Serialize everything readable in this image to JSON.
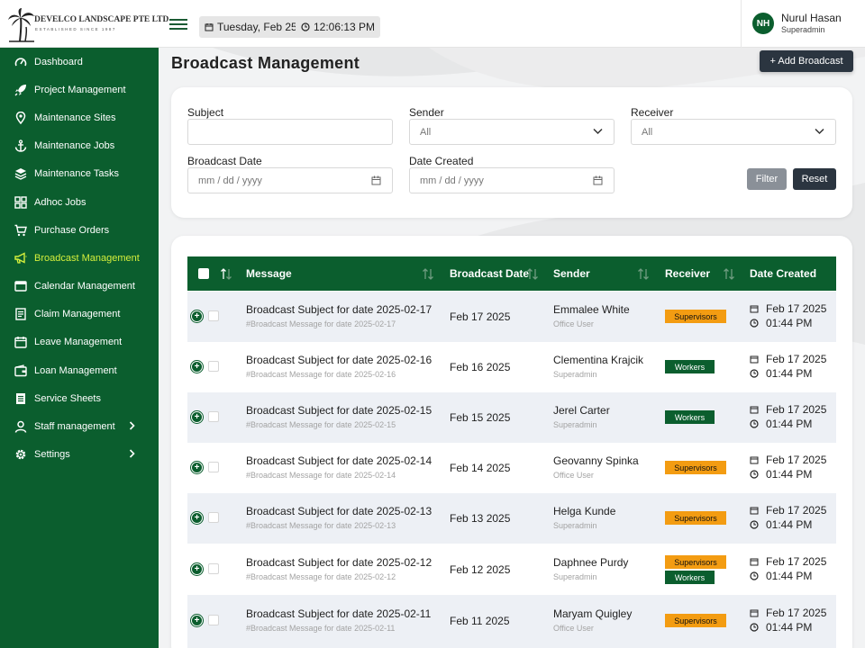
{
  "brand": {
    "name": "DEVELCO LANDSCAPE PTE LTD",
    "tagline": "ESTABLISHED SINCE 1987"
  },
  "header": {
    "date": "Tuesday, Feb 25",
    "time": "12:06:13 PM",
    "user": {
      "initials": "NH",
      "name": "Nurul Hasan",
      "role": "Superadmin"
    }
  },
  "sidebar": {
    "items": [
      {
        "label": "Dashboard",
        "icon": "gauge-icon"
      },
      {
        "label": "Project Management",
        "icon": "rocket-icon"
      },
      {
        "label": "Maintenance Sites",
        "icon": "map-pin-icon"
      },
      {
        "label": "Maintenance Jobs",
        "icon": "anchor-icon"
      },
      {
        "label": "Maintenance Tasks",
        "icon": "layers-icon"
      },
      {
        "label": "Adhoc Jobs",
        "icon": "grid-icon"
      },
      {
        "label": "Purchase Orders",
        "icon": "cart-icon"
      },
      {
        "label": "Broadcast Management",
        "icon": "megaphone-icon",
        "active": true
      },
      {
        "label": "Calendar Management",
        "icon": "calendar-window-icon"
      },
      {
        "label": "Claim Management",
        "icon": "document-icon"
      },
      {
        "label": "Leave Management",
        "icon": "calendar-icon"
      },
      {
        "label": "Loan Management",
        "icon": "wallet-icon"
      },
      {
        "label": "Service Sheets",
        "icon": "sheet-icon"
      },
      {
        "label": "Staff management",
        "icon": "user-icon",
        "has_submenu": true
      },
      {
        "label": "Settings",
        "icon": "gear-icon",
        "has_submenu": true
      }
    ]
  },
  "page": {
    "title": "Broadcast Management",
    "add_button": "+ Add Broadcast"
  },
  "filters": {
    "subject_label": "Subject",
    "subject_value": "",
    "sender_label": "Sender",
    "sender_value": "All",
    "receiver_label": "Receiver",
    "receiver_value": "All",
    "broadcast_date_label": "Broadcast Date",
    "broadcast_date_placeholder": "mm / dd / yyyy",
    "date_created_label": "Date Created",
    "date_created_placeholder": "mm / dd / yyyy",
    "filter_button": "Filter",
    "reset_button": "Reset"
  },
  "table": {
    "columns": [
      "Message",
      "Broadcast Date",
      "Sender",
      "Receiver",
      "Date Created"
    ],
    "rows": [
      {
        "subject": "Broadcast Subject for date 2025-02-17",
        "message": "#Broadcast Message for date 2025-02-17",
        "broadcast_date": "Feb 17 2025",
        "sender": "Emmalee White",
        "sender_role": "Office User",
        "receivers": [
          "Supervisors"
        ],
        "created_date": "Feb 17 2025",
        "created_time": "01:44 PM"
      },
      {
        "subject": "Broadcast Subject for date 2025-02-16",
        "message": "#Broadcast Message for date 2025-02-16",
        "broadcast_date": "Feb 16 2025",
        "sender": "Clementina Krajcik",
        "sender_role": "Superadmin",
        "receivers": [
          "Workers"
        ],
        "created_date": "Feb 17 2025",
        "created_time": "01:44 PM"
      },
      {
        "subject": "Broadcast Subject for date 2025-02-15",
        "message": "#Broadcast Message for date 2025-02-15",
        "broadcast_date": "Feb 15 2025",
        "sender": "Jerel Carter",
        "sender_role": "Superadmin",
        "receivers": [
          "Workers"
        ],
        "created_date": "Feb 17 2025",
        "created_time": "01:44 PM"
      },
      {
        "subject": "Broadcast Subject for date 2025-02-14",
        "message": "#Broadcast Message for date 2025-02-14",
        "broadcast_date": "Feb 14 2025",
        "sender": "Geovanny Spinka",
        "sender_role": "Office User",
        "receivers": [
          "Supervisors"
        ],
        "created_date": "Feb 17 2025",
        "created_time": "01:44 PM"
      },
      {
        "subject": "Broadcast Subject for date 2025-02-13",
        "message": "#Broadcast Message for date 2025-02-13",
        "broadcast_date": "Feb 13 2025",
        "sender": "Helga Kunde",
        "sender_role": "Superadmin",
        "receivers": [
          "Supervisors"
        ],
        "created_date": "Feb 17 2025",
        "created_time": "01:44 PM"
      },
      {
        "subject": "Broadcast Subject for date 2025-02-12",
        "message": "#Broadcast Message for date 2025-02-12",
        "broadcast_date": "Feb 12 2025",
        "sender": "Daphnee Purdy",
        "sender_role": "Superadmin",
        "receivers": [
          "Supervisors",
          "Workers"
        ],
        "created_date": "Feb 17 2025",
        "created_time": "01:44 PM"
      },
      {
        "subject": "Broadcast Subject for date 2025-02-11",
        "message": "#Broadcast Message for date 2025-02-11",
        "broadcast_date": "Feb 11 2025",
        "sender": "Maryam Quigley",
        "sender_role": "Office User",
        "receivers": [
          "Supervisors"
        ],
        "created_date": "Feb 17 2025",
        "created_time": "01:44 PM"
      }
    ]
  },
  "colors": {
    "brand_green": "#0b5e2e",
    "active_nav": "#d4ef3c",
    "supervisors_badge": "#f39c12",
    "workers_badge": "#0b5e2e",
    "dark_button": "#2b3540"
  }
}
